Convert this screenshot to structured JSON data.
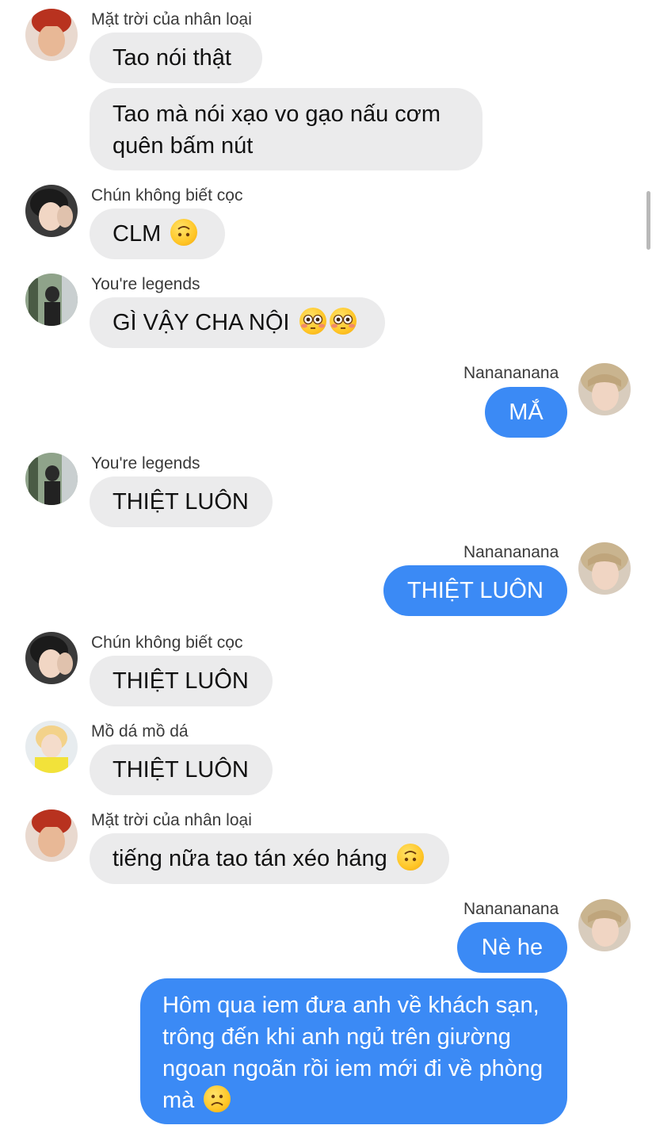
{
  "accent_color": "#3b8af5",
  "incoming_bubble_color": "#ebebec",
  "messages": [
    {
      "sender": "Mặt trời của nhân loại",
      "bubbles": [
        "Tao nói thật",
        "Tao mà nói xạo vo gạo nấu cơm quên bấm nút"
      ]
    },
    {
      "sender": "Chún không biết cọc",
      "bubbles": [
        "CLM"
      ],
      "emoji": "upside-down-face-icon"
    },
    {
      "sender": "You're legends",
      "bubbles": [
        "GÌ VẬY CHA NỘI"
      ],
      "emoji": "flushed-face-icon x2"
    },
    {
      "sender": "Nanananana",
      "bubbles": [
        "MẮ"
      ]
    },
    {
      "sender": "You're legends",
      "bubbles": [
        "THIỆT LUÔN"
      ]
    },
    {
      "sender": "Nanananana",
      "bubbles": [
        "THIỆT LUÔN"
      ]
    },
    {
      "sender": "Chún không biết cọc",
      "bubbles": [
        "THIỆT LUÔN"
      ]
    },
    {
      "sender": "Mồ dá mồ dá",
      "bubbles": [
        "THIỆT LUÔN"
      ]
    },
    {
      "sender": "Mặt trời của nhân loại",
      "bubbles": [
        "tiếng nữa tao tán xéo háng"
      ],
      "emoji": "upside-down-face-icon"
    },
    {
      "sender": "Nanananana",
      "bubbles": [
        "Nè he",
        "Hôm qua iem đưa anh  về khách sạn, trông đến khi anh ngủ trên giường ngoan ngoãn rồi iem mới đi về phòng mà"
      ],
      "emoji": "frowning-face-icon"
    }
  ]
}
